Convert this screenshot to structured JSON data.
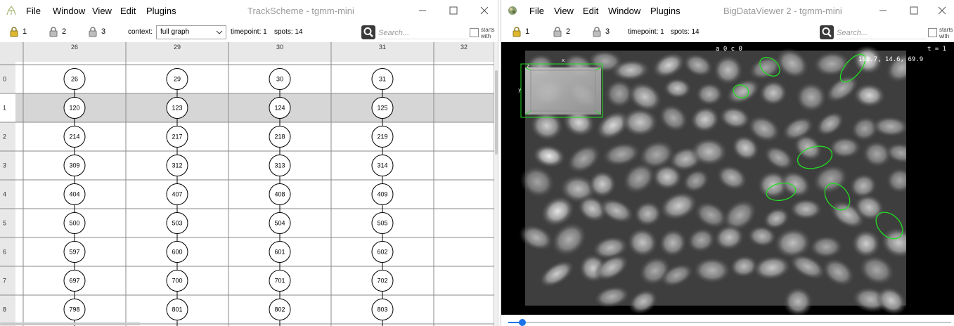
{
  "trackscheme": {
    "title": "TrackScheme - tgmm-mini",
    "menu": [
      "File",
      "Window",
      "View",
      "Edit",
      "Plugins"
    ],
    "locks": [
      "1",
      "2",
      "3"
    ],
    "context_label": "context:",
    "context_value": "full graph",
    "timepoint": "timepoint: 1",
    "spots": "spots: 14",
    "search_placeholder": "Search...",
    "starts_with": "starts with",
    "columns": [
      "26",
      "29",
      "30",
      "31",
      "32"
    ],
    "rows": [
      "0",
      "1",
      "2",
      "3",
      "4",
      "5",
      "6",
      "7",
      "8"
    ],
    "selected_row": 1,
    "tracks": [
      [
        "26",
        "120",
        "214",
        "309",
        "404",
        "500",
        "597",
        "697",
        "798"
      ],
      [
        "29",
        "123",
        "217",
        "312",
        "407",
        "503",
        "600",
        "700",
        "801"
      ],
      [
        "30",
        "124",
        "218",
        "313",
        "408",
        "504",
        "601",
        "701",
        "802"
      ],
      [
        "31",
        "125",
        "219",
        "314",
        "409",
        "505",
        "602",
        "702",
        "803"
      ]
    ]
  },
  "bigdataviewer": {
    "title": "BigDataViewer 2 - tgmm-mini",
    "menu": [
      "File",
      "View",
      "Edit",
      "Window",
      "Plugins"
    ],
    "locks": [
      "1",
      "2",
      "3"
    ],
    "timepoint": "timepoint: 1",
    "spots": "spots: 14",
    "search_placeholder": "Search...",
    "starts_with": "starts with",
    "overlay_source": "a 0 c 0",
    "overlay_time": "t = 1",
    "overlay_coords": "169.7,    14.6,    69.9",
    "box_axis_z": "z",
    "box_axis_x": "x",
    "box_axis_y": "y",
    "slider_value": 0,
    "spot_color": "#22dd22"
  }
}
